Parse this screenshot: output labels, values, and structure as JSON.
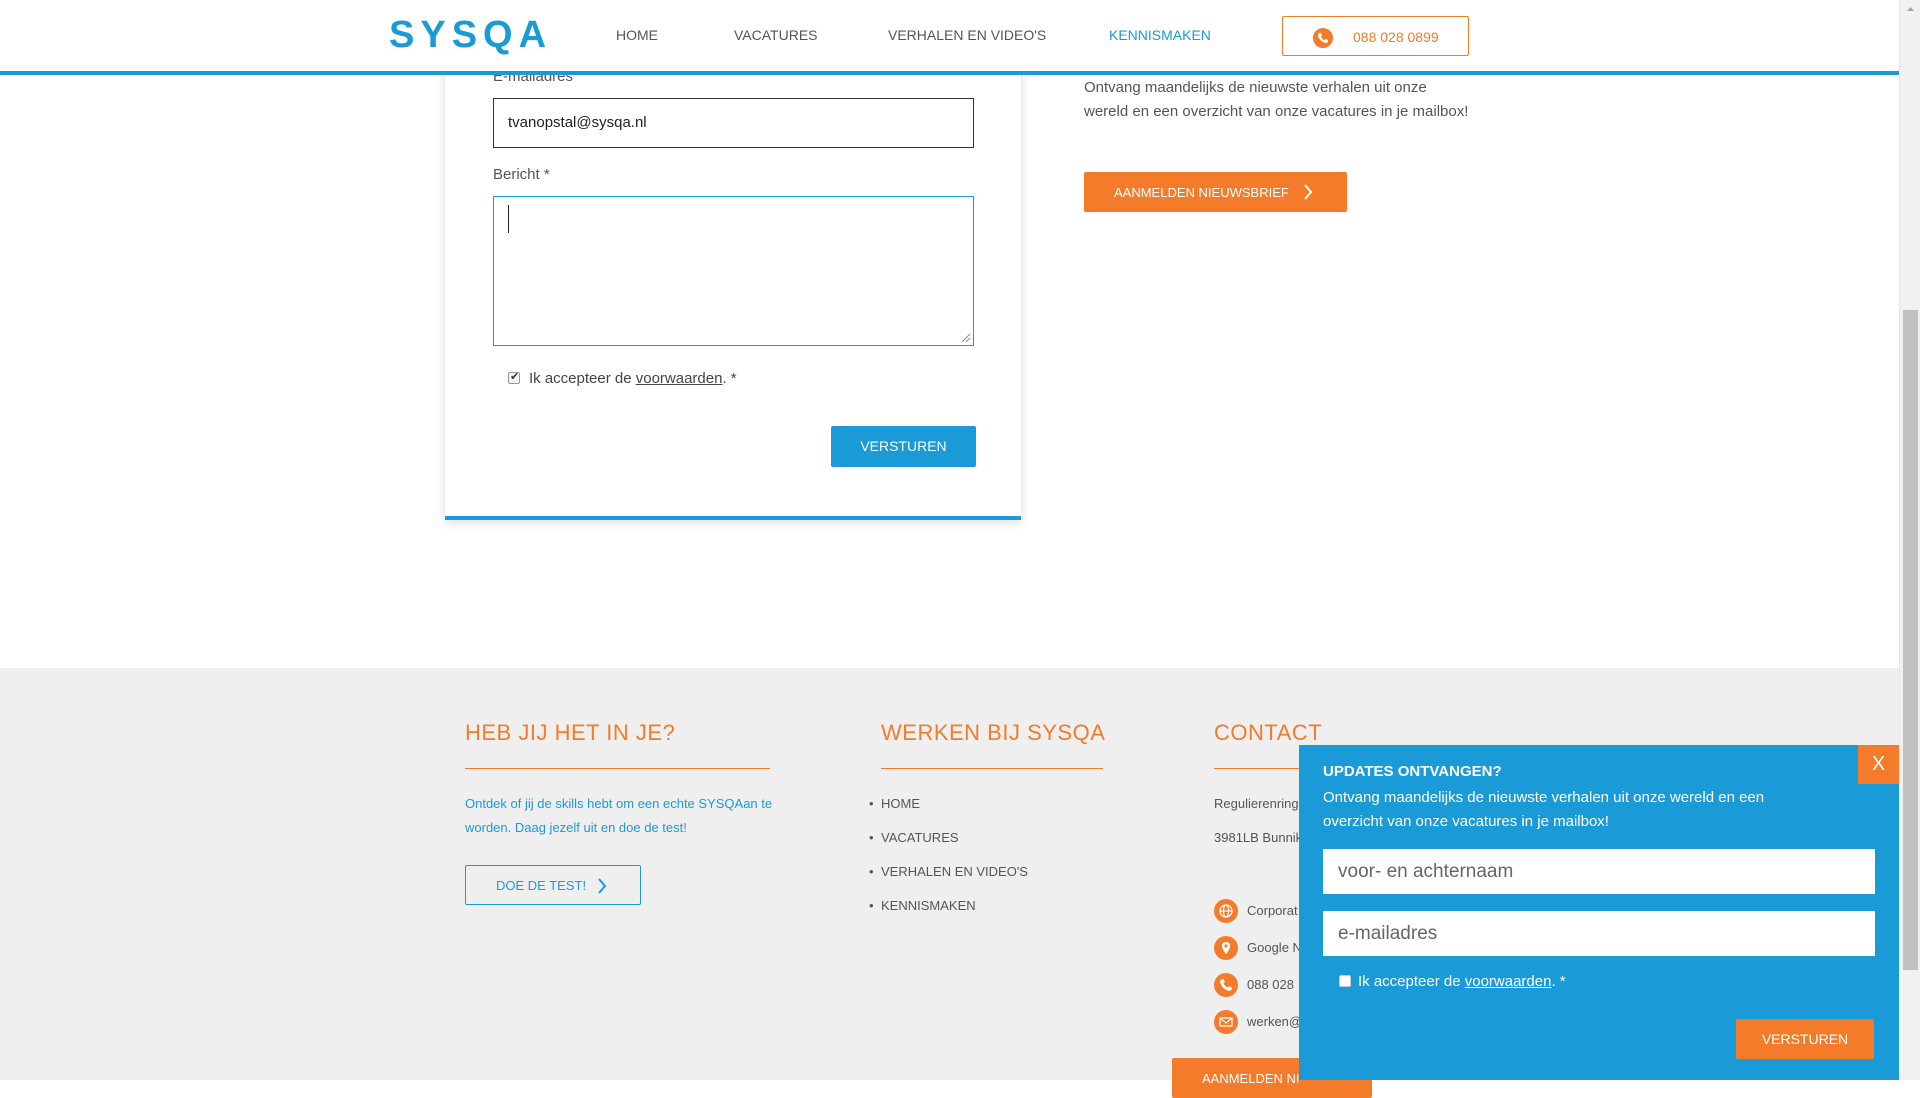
{
  "header": {
    "logo": "SYSQA",
    "nav": [
      "HOME",
      "VACATURES",
      "VERHALEN EN VIDEO'S",
      "KENNISMAKEN"
    ],
    "phone": "088 028 0899"
  },
  "form": {
    "email_label": "E-mailadres",
    "email_value": "tvanopstal@sysqa.nl",
    "message_label": "Bericht *",
    "terms_prefix": "Ik accepteer de",
    "terms_link": "voorwaarden",
    "terms_suffix": ". *",
    "submit": "VERSTUREN"
  },
  "newsletter": {
    "text": "Ontvang maandelijks de nieuwste verhalen uit onze wereld en een overzicht van onze vacatures in je mailbox!",
    "button": "AANMELDEN NIEUWSBRIEF"
  },
  "footer": {
    "col1": {
      "title": "HEB JIJ HET IN JE?",
      "text": "Ontdek of jij de skills hebt om een echte SYSQAan te worden. Daag jezelf uit en doe de test!",
      "button": "DOE DE TEST!"
    },
    "col2": {
      "title": "WERKEN BIJ SYSQA",
      "links": [
        "HOME",
        "VACATURES",
        "VERHALEN EN VIDEO'S",
        "KENNISMAKEN"
      ]
    },
    "col3": {
      "title": "CONTACT",
      "address1": "Regulierenring",
      "address2": "3981LB Bunnik",
      "items": [
        "Corporat",
        "Google N",
        "088 028",
        "werken@"
      ],
      "button": "AANMELDEN NI"
    }
  },
  "popup": {
    "close": "X",
    "title": "UPDATES ONTVANGEN?",
    "text": "Ontvang maandelijks de nieuwste verhalen uit onze wereld en een overzicht van onze vacatures in je mailbox!",
    "name_placeholder": "voor- en achternaam",
    "email_placeholder": "e-mailadres",
    "terms_prefix": "Ik accepteer de",
    "terms_link": "voorwaarden",
    "terms_suffix": ". *",
    "submit": "VERSTUREN"
  },
  "colors": {
    "brand_blue": "#1a9bd7",
    "accent_orange": "#f47b2a"
  }
}
